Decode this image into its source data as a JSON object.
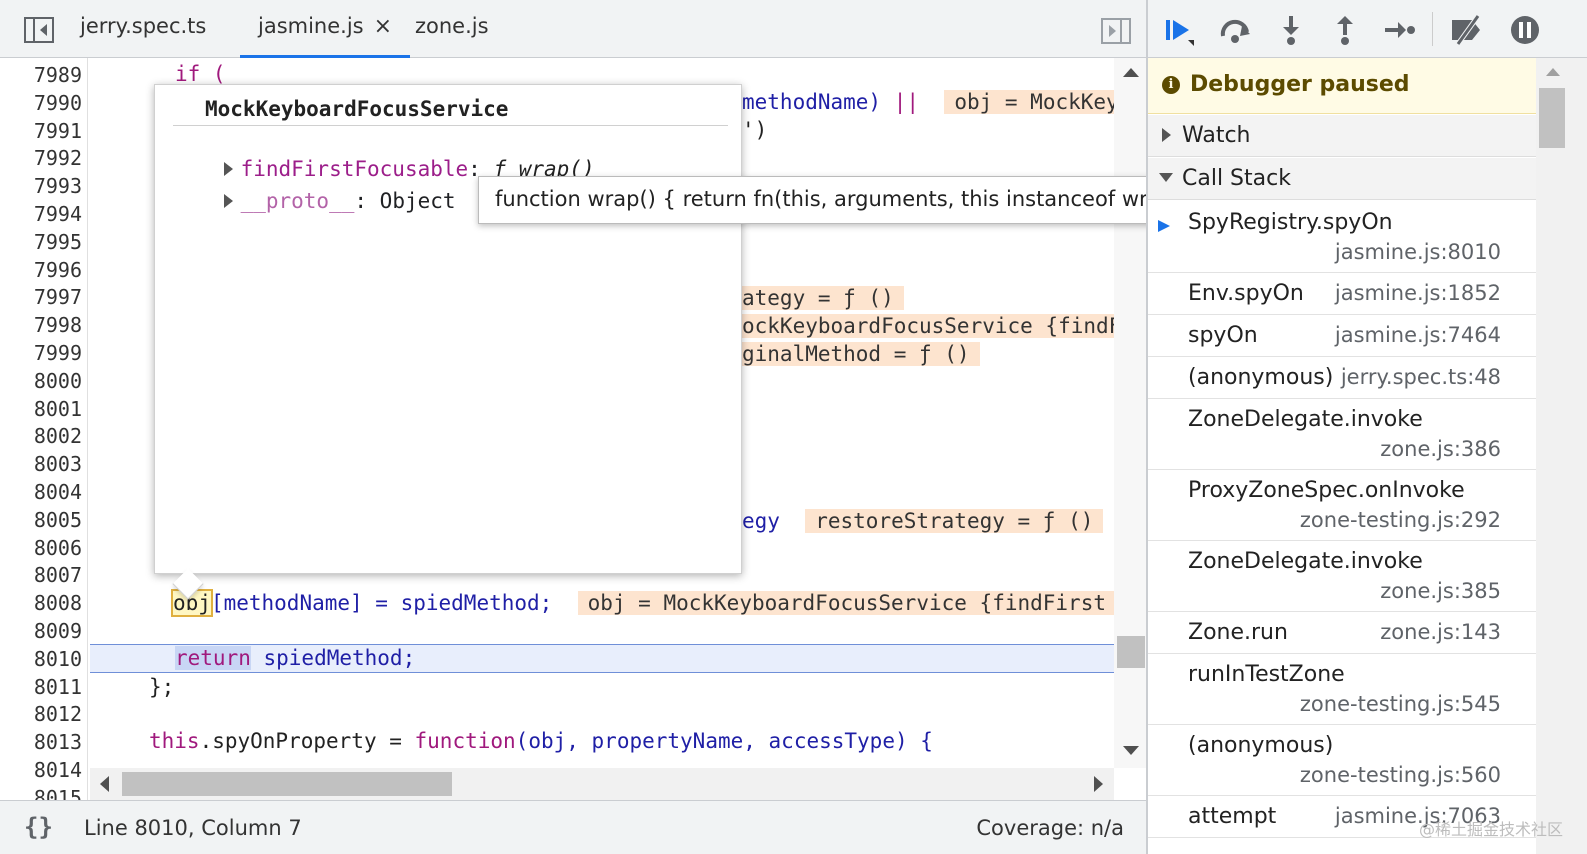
{
  "tabs": [
    {
      "label": "jerry.spec.ts",
      "active": false
    },
    {
      "label": "jasmine.js",
      "active": true,
      "close": "×"
    },
    {
      "label": "zone.js",
      "active": false
    }
  ],
  "editor": {
    "line_numbers": [
      "7989",
      "7990",
      "7991",
      "7992",
      "7993",
      "7994",
      "7995",
      "7996",
      "7997",
      "7998",
      "7999",
      "8000",
      "8001",
      "8002",
      "8003",
      "8004",
      "8005",
      "8006",
      "8007",
      "8008",
      "8009",
      "8010",
      "8011",
      "8012",
      "8013",
      "8014",
      "8015"
    ],
    "visible_code": {
      "l7989": "if (",
      "l7990_a": "methodName) ",
      "l7990_b": "||",
      "l7990_val": "obj = MockKey",
      "l7991": "')",
      "l7997_val": "ategy = ƒ ()",
      "l7998_val": "ockKeyboardFocusService {findF",
      "l7999_val": "ginalMethod = ƒ ()",
      "l8005_a": "egy",
      "l8005_val": "restoreStrategy = ƒ ()",
      "l8008_obj": "obj",
      "l8008_rest": "[methodName] = spiedMethod;",
      "l8008_val": "obj = MockKeyboardFocusService {findFirst",
      "l8010_kw": "return",
      "l8010_rest": " spiedMethod;",
      "l8011": "};",
      "l8013_this": "this",
      "l8013_mid": ".spyOnProperty = ",
      "l8013_fn": "function",
      "l8013_params": "(obj, propertyName, accessType) {"
    },
    "execution_line": "8010"
  },
  "popover": {
    "title": "MockKeyboardFocusService",
    "properties": [
      {
        "name": "findFirstFocusable",
        "sep": ": ",
        "value": "ƒ wrap()"
      },
      {
        "name": "__proto__",
        "sep": ": ",
        "value": "Object"
      }
    ]
  },
  "tooltip": {
    "text": "function wrap() { return fn(this, arguments, this instanceof wrap); }"
  },
  "status": {
    "braces": "{}",
    "position": "Line 8010, Column 7",
    "coverage": "Coverage: n/a"
  },
  "debugger": {
    "toolbar_icons": [
      "resume-icon",
      "step-over-icon",
      "step-into-icon",
      "step-out-icon",
      "step-icon",
      "deactivate-breakpoints-icon",
      "pause-on-exceptions-icon"
    ],
    "paused_text": "Debugger paused",
    "paused_icon": "i",
    "watch_label": "Watch",
    "callstack_label": "Call Stack",
    "frames": [
      {
        "name": "SpyRegistry.spyOn",
        "location": "jasmine.js:8010"
      },
      {
        "name": "Env.spyOn",
        "location": "jasmine.js:1852"
      },
      {
        "name": "spyOn",
        "location": "jasmine.js:7464"
      },
      {
        "name": "(anonymous)",
        "location": "jerry.spec.ts:48"
      },
      {
        "name": "ZoneDelegate.invoke",
        "location": "zone.js:386"
      },
      {
        "name": "ProxyZoneSpec.onInvoke",
        "location": "zone-testing.js:292"
      },
      {
        "name": "ZoneDelegate.invoke",
        "location": "zone.js:385"
      },
      {
        "name": "Zone.run",
        "location": "zone.js:143"
      },
      {
        "name": "runInTestZone",
        "location": "zone-testing.js:545"
      },
      {
        "name": "(anonymous)",
        "location": "zone-testing.js:560"
      },
      {
        "name": "attempt",
        "location": "jasmine.js:7063"
      }
    ],
    "watermark": "@稀土掘金技术社区"
  },
  "colors": {
    "accent": "#1a73e8",
    "keyword": "#a0197d",
    "value_bg": "#fde4cf",
    "paused_bg": "#fffbe5"
  }
}
